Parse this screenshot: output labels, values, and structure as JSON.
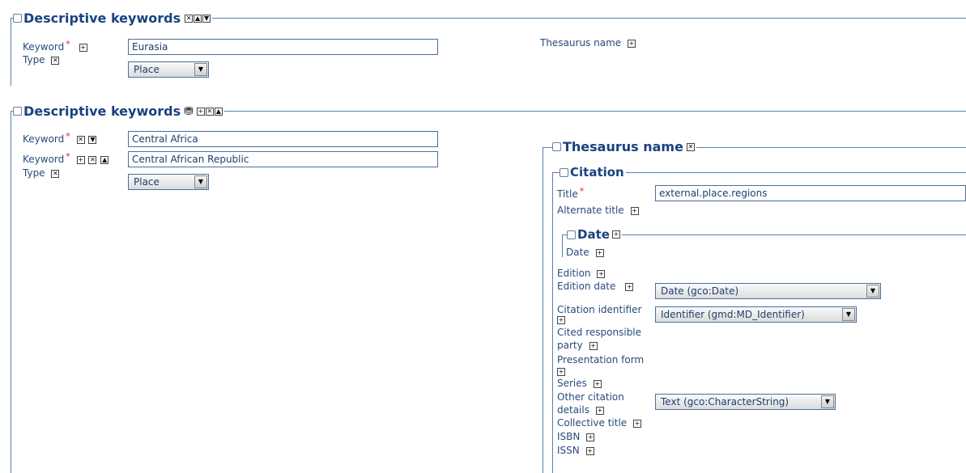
{
  "section1": {
    "title": "Descriptive keywords",
    "keyword_label": "Keyword",
    "keyword_value": "Eurasia",
    "type_label": "Type",
    "type_value": "Place",
    "thesaurus_label": "Thesaurus name"
  },
  "section2": {
    "title": "Descriptive keywords",
    "keyword_label": "Keyword",
    "keyword1_value": "Central Africa",
    "keyword2_value": "Central African Republic",
    "type_label": "Type",
    "type_value": "Place",
    "thesaurus": {
      "title": "Thesaurus name",
      "citation": {
        "title": "Citation",
        "title_label": "Title",
        "title_value": "external.place.regions",
        "alternate_title_label": "Alternate title",
        "date_section_title": "Date",
        "date_label": "Date",
        "edition_label": "Edition",
        "edition_date_label": "Edition date",
        "edition_date_value": "Date (gco:Date)",
        "citation_identifier_label": "Citation identifier",
        "citation_identifier_value": "Identifier (gmd:MD_Identifier)",
        "cited_responsible_party_label_1": "Cited responsible",
        "cited_responsible_party_label_2": "party",
        "presentation_form_label": "Presentation form",
        "series_label": "Series",
        "other_citation_details_label_1": "Other citation",
        "other_citation_details_label_2": "details",
        "other_citation_details_value": "Text (gco:CharacterString)",
        "collective_title_label": "Collective title",
        "isbn_label": "ISBN",
        "issn_label": "ISSN"
      }
    }
  },
  "icons": {
    "plus": "+",
    "remove": "✕",
    "up": "▲",
    "down": "▼",
    "binoculars": "⛃",
    "required": "*"
  }
}
